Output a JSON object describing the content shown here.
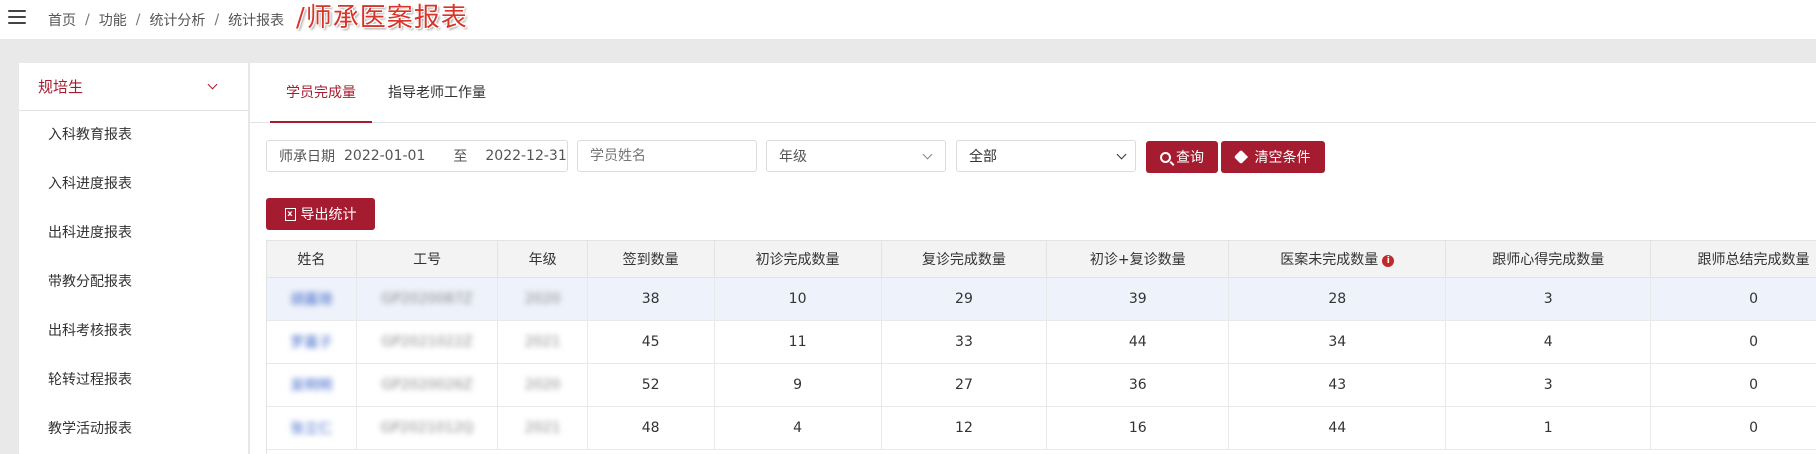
{
  "breadcrumb": [
    "首页",
    "功能",
    "统计分析",
    "统计报表"
  ],
  "page_title": "/师承医案报表",
  "sidebar": {
    "group": "规培生",
    "items": [
      "入科教育报表",
      "入科进度报表",
      "出科进度报表",
      "带教分配报表",
      "出科考核报表",
      "轮转过程报表",
      "教学活动报表"
    ]
  },
  "tabs": [
    "学员完成量",
    "指导老师工作量"
  ],
  "filters": {
    "date_label": "师承日期",
    "date_start": "2022-01-01",
    "date_to": "至",
    "date_end": "2022-12-31",
    "student_name_placeholder": "学员姓名",
    "grade_placeholder": "年级",
    "status_value": "全部"
  },
  "buttons": {
    "query": "查询",
    "clear": "清空条件",
    "export": "导出统计"
  },
  "table": {
    "headers": [
      "姓名",
      "工号",
      "年级",
      "签到数量",
      "初诊完成数量",
      "复诊完成数量",
      "初诊+复诊数量",
      "医案未完成数量",
      "跟师心得完成数量",
      "跟师总结完成数量"
    ],
    "rows": [
      {
        "name": "胡嘉琦",
        "id": "GP2020087Z",
        "grade": "2020",
        "signin": "38",
        "first": "10",
        "revisit": "29",
        "total": "39",
        "unfinished": "28",
        "notes": "3",
        "summary": "0"
      },
      {
        "name": "罗嘉子",
        "id": "GP2021022Z",
        "grade": "2021",
        "signin": "45",
        "first": "11",
        "revisit": "33",
        "total": "44",
        "unfinished": "34",
        "notes": "4",
        "summary": "0"
      },
      {
        "name": "吴明明",
        "id": "GP2020026Z",
        "grade": "2020",
        "signin": "52",
        "first": "9",
        "revisit": "27",
        "total": "36",
        "unfinished": "43",
        "notes": "3",
        "summary": "0"
      },
      {
        "name": "张立仁",
        "id": "GP2021012Q",
        "grade": "2021",
        "signin": "48",
        "first": "4",
        "revisit": "12",
        "total": "16",
        "unfinished": "44",
        "notes": "1",
        "summary": "0"
      }
    ]
  },
  "icons": {
    "menu": "hamburger-icon",
    "search": "search-icon",
    "clear": "tags-icon",
    "export": "excel-icon",
    "info": "info-circle-icon"
  },
  "colors": {
    "brand": "#a51c30",
    "title": "#d7342a",
    "highlight_row": "#eef2fa"
  }
}
